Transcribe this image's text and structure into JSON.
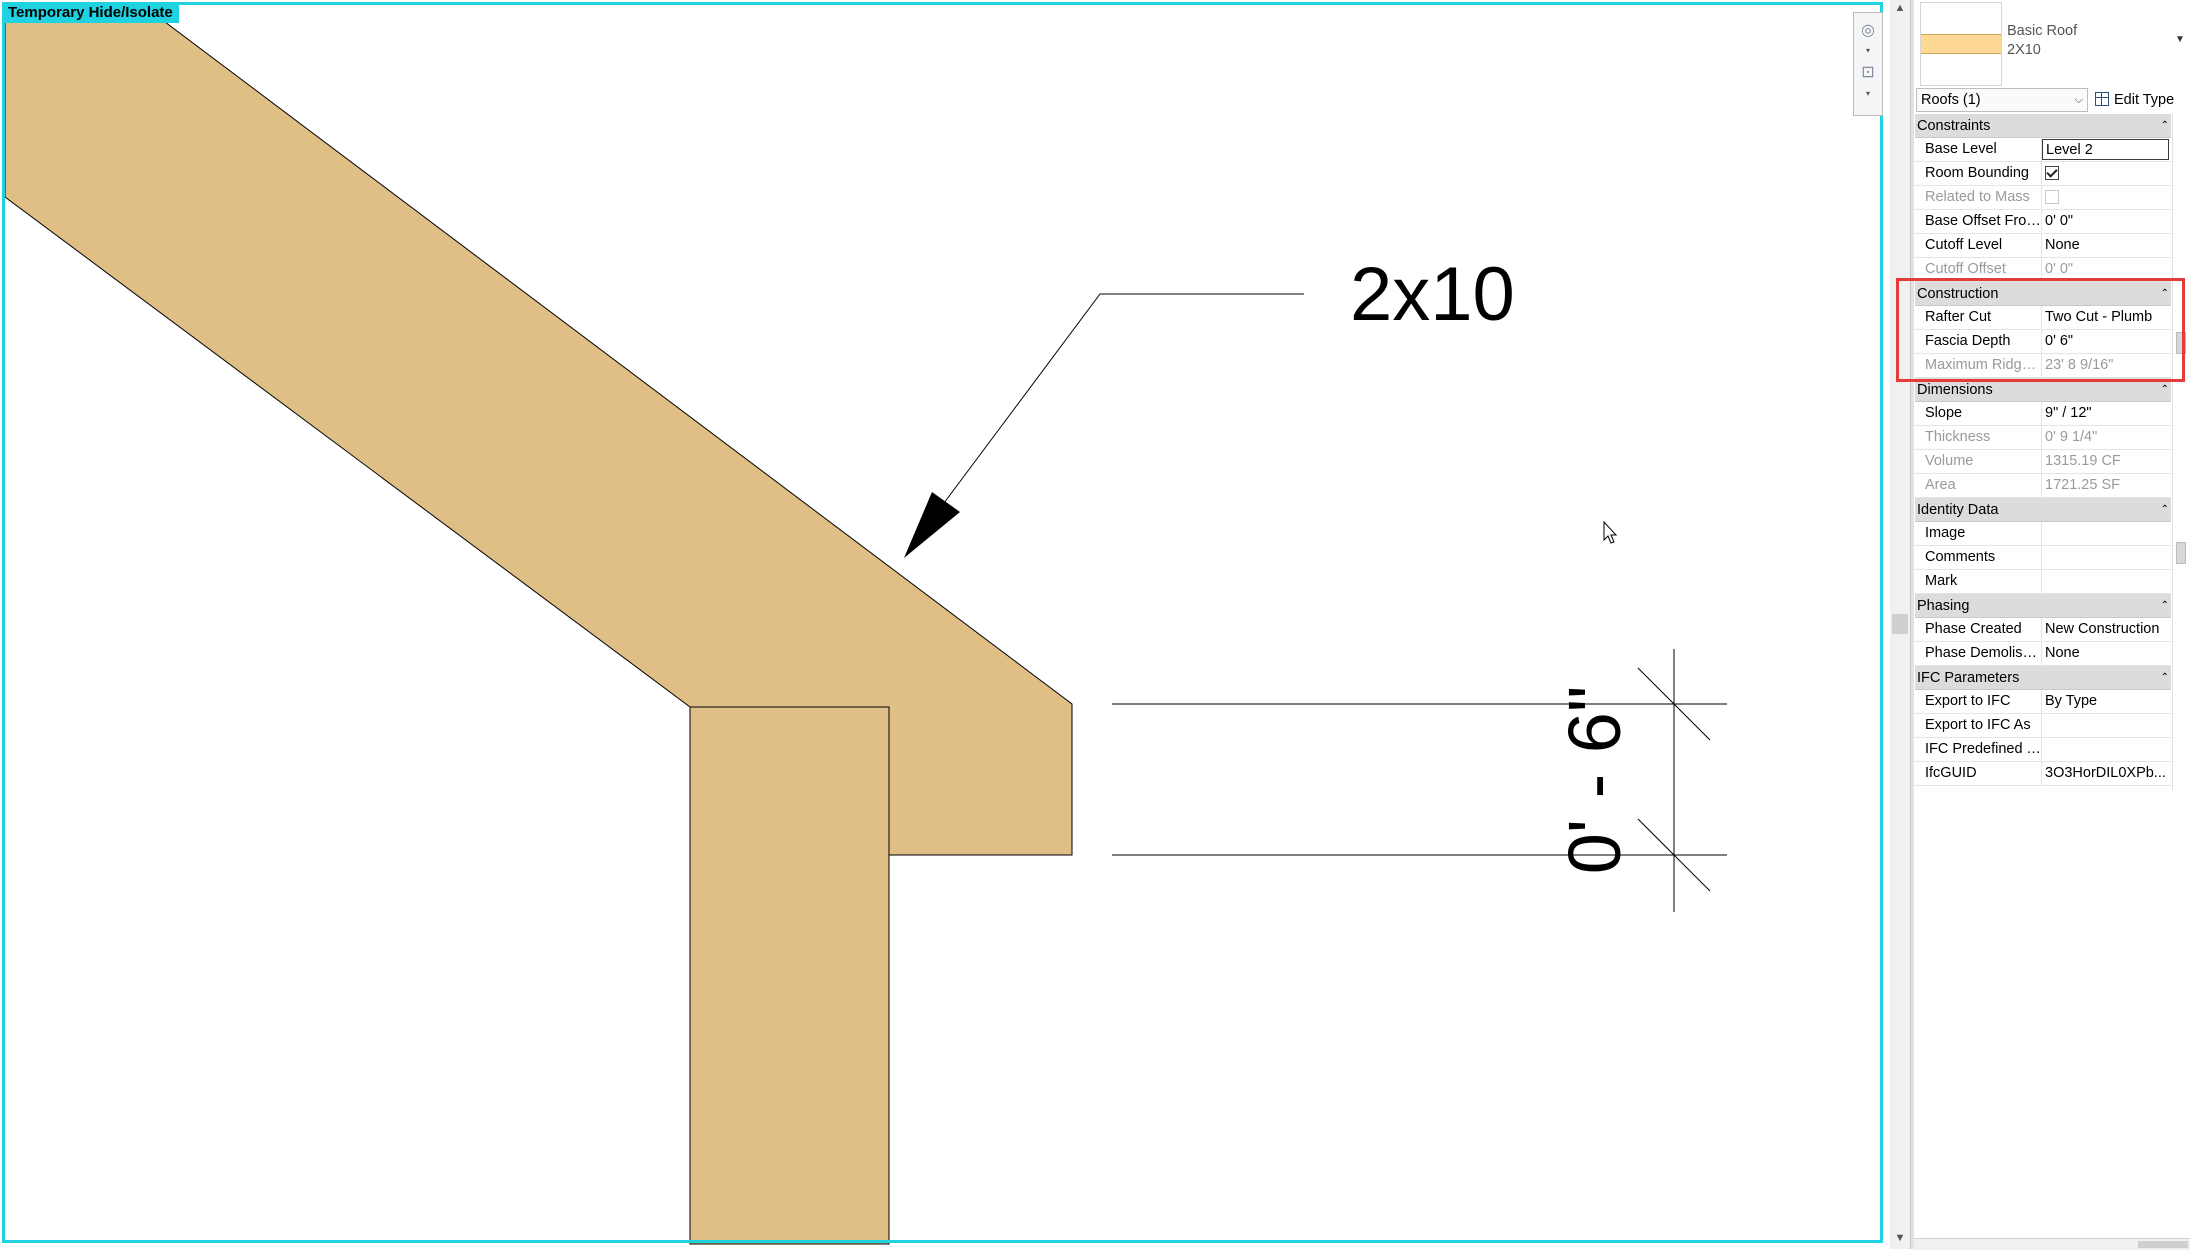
{
  "view": {
    "isolate_label": "Temporary Hide/Isolate",
    "tag_text": "2x10",
    "dimension_text": "0' - 6\"",
    "colors": {
      "wood": "#dfbf86",
      "isolate_frame": "#1ed3df",
      "highlight": "#e63b3b"
    }
  },
  "properties": {
    "type_family": "Basic Roof",
    "type_name": "2X10",
    "instance_filter": "Roofs (1)",
    "edit_type_label": "Edit Type",
    "groups": {
      "constraints": {
        "title": "Constraints",
        "rows": [
          {
            "label": "Base Level",
            "value": "Level 2"
          },
          {
            "label": "Room Bounding",
            "value": "checked"
          },
          {
            "label": "Related to Mass",
            "value": "unchecked"
          },
          {
            "label": "Base Offset From Level",
            "value": "0'  0\""
          },
          {
            "label": "Cutoff Level",
            "value": "None"
          },
          {
            "label": "Cutoff Offset",
            "value": "0'  0\""
          }
        ]
      },
      "construction": {
        "title": "Construction",
        "rows": [
          {
            "label": "Rafter Cut",
            "value": "Two Cut - Plumb"
          },
          {
            "label": "Fascia Depth",
            "value": "0'  6\""
          },
          {
            "label": "Maximum Ridge Height",
            "value": "23'  8 9/16\""
          }
        ]
      },
      "dimensions": {
        "title": "Dimensions",
        "rows": [
          {
            "label": "Slope",
            "value": "9\" / 12\""
          },
          {
            "label": "Thickness",
            "value": "0'  9 1/4\""
          },
          {
            "label": "Volume",
            "value": "1315.19 CF"
          },
          {
            "label": "Area",
            "value": "1721.25 SF"
          }
        ]
      },
      "identity": {
        "title": "Identity Data",
        "rows": [
          {
            "label": "Image",
            "value": ""
          },
          {
            "label": "Comments",
            "value": ""
          },
          {
            "label": "Mark",
            "value": ""
          }
        ]
      },
      "phasing": {
        "title": "Phasing",
        "rows": [
          {
            "label": "Phase Created",
            "value": "New Construction"
          },
          {
            "label": "Phase Demolished",
            "value": "None"
          }
        ]
      },
      "ifc": {
        "title": "IFC Parameters",
        "rows": [
          {
            "label": "Export to IFC",
            "value": "By Type"
          },
          {
            "label": "Export to IFC As",
            "value": ""
          },
          {
            "label": "IFC Predefined Type",
            "value": ""
          },
          {
            "label": "IfcGUID",
            "value": "3O3HorDIL0XPb..."
          }
        ]
      }
    }
  }
}
